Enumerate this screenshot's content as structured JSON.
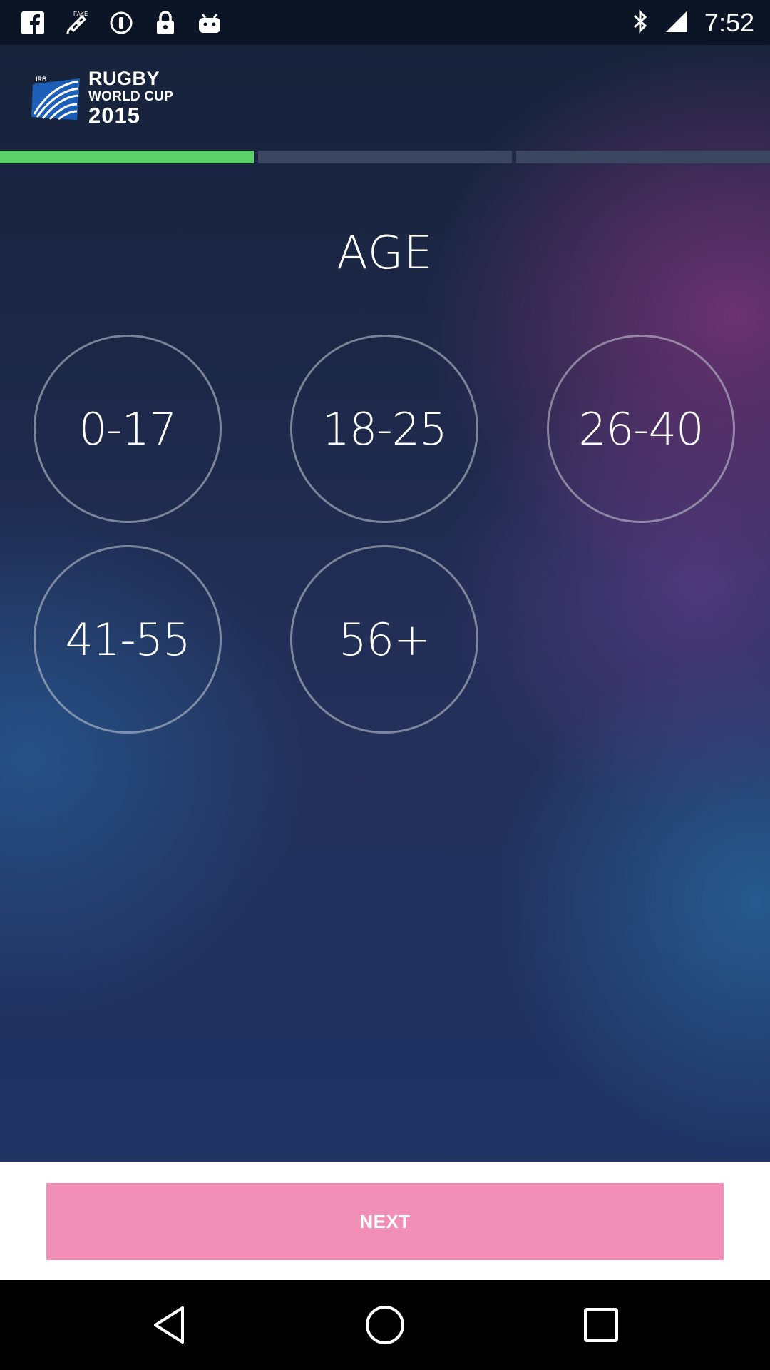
{
  "status_bar": {
    "time": "7:52",
    "icons": [
      "facebook-icon",
      "fake-gps-icon",
      "info-icon",
      "lock-icon",
      "android-icon",
      "bluetooth-icon",
      "signal-icon"
    ]
  },
  "logo": {
    "badge": "IRB",
    "line1": "RUGBY",
    "line2": "WORLD CUP",
    "line3": "2015"
  },
  "progress": {
    "steps": 3,
    "current_step": 1
  },
  "question": {
    "title": "AGE"
  },
  "age_options": [
    {
      "label": "0-17"
    },
    {
      "label": "18-25"
    },
    {
      "label": "26-40"
    },
    {
      "label": "41-55"
    },
    {
      "label": "56+"
    }
  ],
  "footer": {
    "next_label": "NEXT"
  },
  "colors": {
    "progress_active": "#5cd069",
    "progress_inactive": "#3a4560",
    "next_button": "#f28fb6"
  },
  "nav_bar": {
    "icons": [
      "back-icon",
      "home-icon",
      "recent-apps-icon"
    ]
  }
}
